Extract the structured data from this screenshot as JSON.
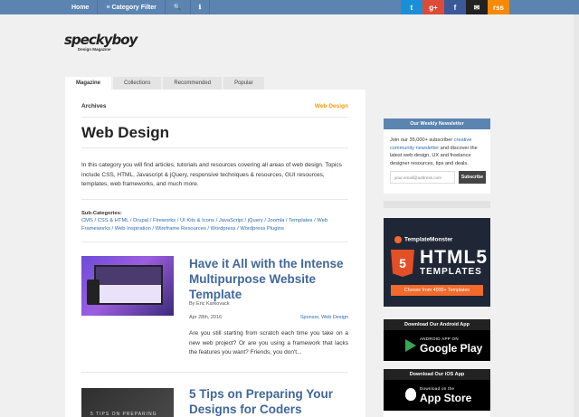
{
  "topbar": {
    "nav": [
      "Home",
      "≡ Category Filter",
      "🔍",
      "ℹ"
    ],
    "social": [
      "t",
      "g+",
      "f",
      "✉",
      "rss"
    ]
  },
  "logo": {
    "word": "speckyboy",
    "sub": "Design Magazine"
  },
  "tabs": [
    "Magazine",
    "Collections",
    "Recommended",
    "Popular"
  ],
  "main": {
    "crumb_left": "Archives",
    "crumb_right": "Web Design",
    "title": "Web Design",
    "intro": "In this category you will find articles, tutorials and resources covering all areas of web design. Topics include CSS, HTML, Javascript & jQuery, responsive techniques & resources, GUI resources, templates, web frameworks, and much more.",
    "subcats_label": "Sub-Categories:",
    "subcats": "CMS / CSS & HTML / Drupal / Fireworks / UI Kits & Icons / JavaScript / jQuery / Joomla / Templates / Web Frameworks / Web Inspiration / Wireframe Resources / Wordpress / Wordpress Plugins"
  },
  "articles": [
    {
      "title": "Have it All with the Intense Multipurpose Website Template",
      "author": "By Eric Karkovack",
      "date": "Apr 28th, 2016",
      "cats": "Sponsor, Web Design",
      "excerpt": "Are you still starting from scratch each time you take on a new web project? Or are you using a framework that lacks the features you want? Friends, you don't..."
    },
    {
      "title": "5 Tips on Preparing Your Designs for Coders",
      "thumb_text": "5 TIPS ON PREPARING"
    }
  ],
  "sidebar": {
    "newsletter_head": "Our Weekly Newsletter",
    "newsletter_text_1": "Join our 35,000+ subscriber ",
    "newsletter_link": "creative community newsletter",
    "newsletter_text_2": " and discover the latest web design, UX and freelance designer resources, tips and deals.",
    "email_placeholder": "your.email@address.com",
    "subscribe": "Subscribe",
    "ad_brand": "TemplateMonster",
    "ad_shield": "5",
    "ad_html5": "HTML5",
    "ad_templates": "TEMPLATES",
    "ad_cta": "Choose from 4000+ Templates",
    "android_head": "Download Our Android App",
    "android_small": "ANDROID APP ON",
    "android_big": "Google Play",
    "ios_head": "Download Our iOS App",
    "ios_small": "Download on the",
    "ios_big": "App Store"
  },
  "colors": {
    "topbar": "#5b84b1",
    "accent_orange": "#f39c12",
    "link_blue": "#2b6cb0",
    "title_blue": "#41679b"
  }
}
